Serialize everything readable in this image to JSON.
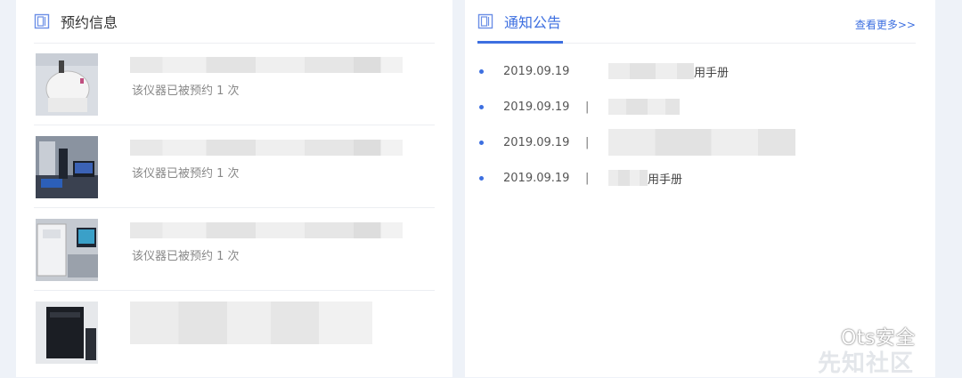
{
  "booking": {
    "title": "预约信息",
    "items": [
      {
        "count_text": "该仪器已被预约 1 次"
      },
      {
        "count_text": "该仪器已被预约 1 次"
      },
      {
        "count_text": "该仪器已被预约 1 次"
      },
      {
        "count_text": ""
      }
    ]
  },
  "notices": {
    "tab_label": "通知公告",
    "more_label": "查看更多>>",
    "items": [
      {
        "date": "2019.09.19",
        "sep": "|",
        "title_tail": "用手册"
      },
      {
        "date": "2019.09.19",
        "sep": "|",
        "title_tail": ""
      },
      {
        "date": "2019.09.19",
        "sep": "|",
        "title_tail": ""
      },
      {
        "date": "2019.09.19",
        "sep": "|",
        "title_tail": "用手册"
      }
    ]
  },
  "watermark": {
    "primary": "Ots安全",
    "secondary": "先知社区"
  },
  "colors": {
    "accent": "#3d6fe0",
    "background": "#eef2f8",
    "panel": "#ffffff"
  }
}
